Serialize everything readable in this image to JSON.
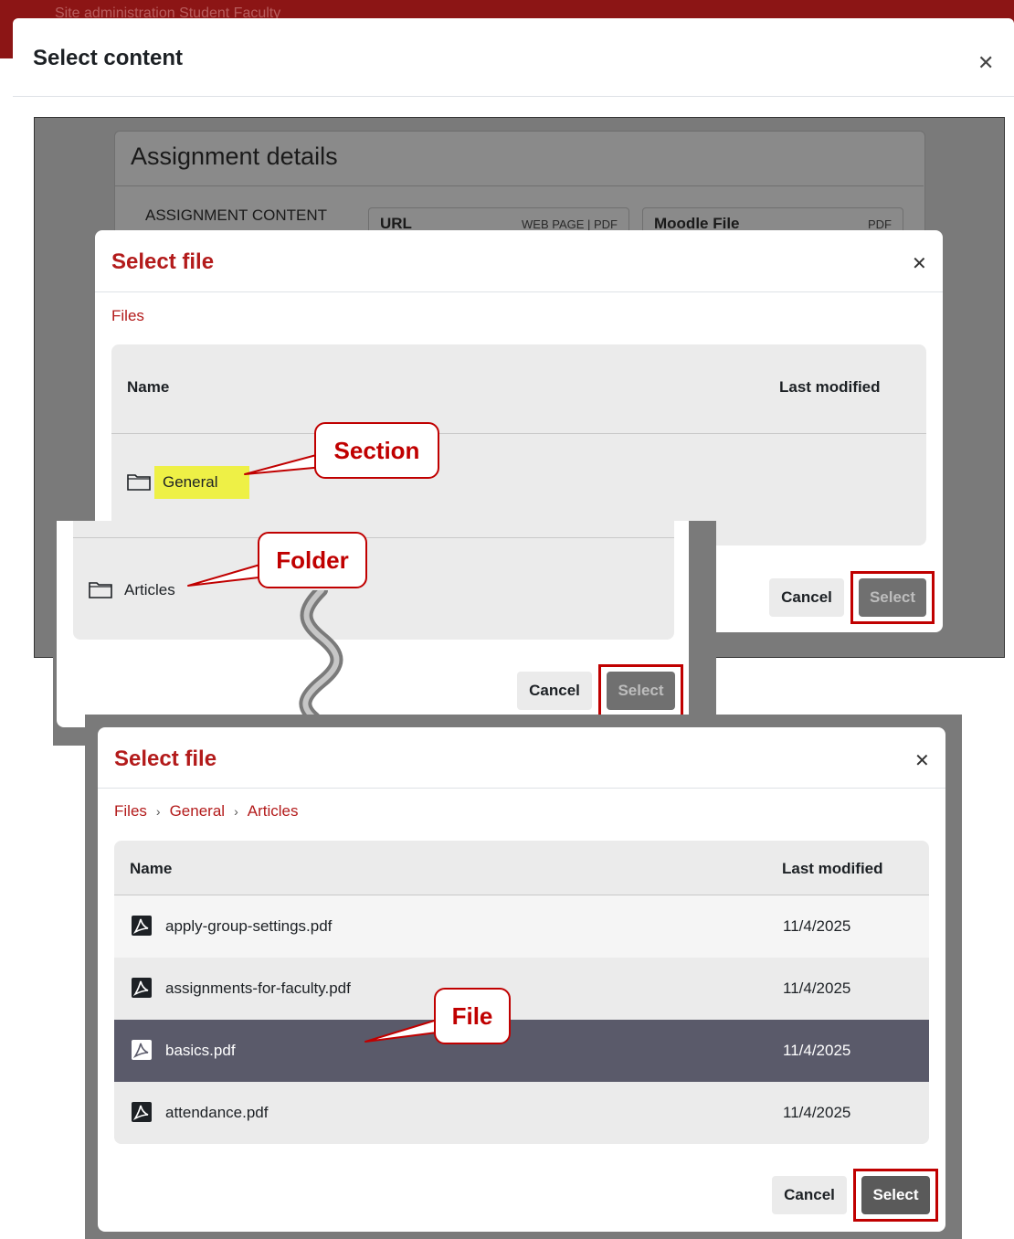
{
  "page_nav": {
    "text": "Site administration    Student    Faculty"
  },
  "content_modal": {
    "title": "Select content",
    "close_icon": "close-icon"
  },
  "assignment": {
    "title": "Assignment details",
    "content_label": "ASSIGNMENT CONTENT",
    "options": [
      {
        "name": "URL",
        "kind": "WEB PAGE | PDF"
      },
      {
        "name": "Moodle File",
        "kind": "PDF"
      }
    ]
  },
  "file_dialog_1": {
    "title": "Select file",
    "breadcrumb": [
      "Files"
    ],
    "columns": {
      "name": "Name",
      "modified": "Last modified"
    },
    "rows": [
      {
        "name": "General",
        "icon": "folder-icon"
      }
    ],
    "cancel_label": "Cancel",
    "select_label": "Select"
  },
  "file_dialog_2": {
    "rows": [
      {
        "name": "Articles",
        "icon": "folder-icon"
      }
    ],
    "cancel_label": "Cancel",
    "select_label": "Select"
  },
  "file_dialog_3": {
    "title": "Select file",
    "breadcrumb": [
      "Files",
      "General",
      "Articles"
    ],
    "breadcrumb_separator": "›",
    "columns": {
      "name": "Name",
      "modified": "Last modified"
    },
    "rows": [
      {
        "name": "apply-group-settings.pdf",
        "modified": "11/4/2025",
        "icon": "pdf-icon",
        "selected": false
      },
      {
        "name": "assignments-for-faculty.pdf",
        "modified": "11/4/2025",
        "icon": "pdf-icon",
        "selected": false
      },
      {
        "name": "basics.pdf",
        "modified": "11/4/2025",
        "icon": "pdf-icon",
        "selected": true
      },
      {
        "name": "attendance.pdf",
        "modified": "11/4/2025",
        "icon": "pdf-icon",
        "selected": false
      }
    ],
    "cancel_label": "Cancel",
    "select_label": "Select"
  },
  "callouts": {
    "section": "Section",
    "folder": "Folder",
    "file": "File"
  },
  "colors": {
    "brand_red": "#b31b1b",
    "callout_red": "#c00000",
    "highlight_yellow": "#eef046",
    "selected_row": "#5a5a6a"
  }
}
